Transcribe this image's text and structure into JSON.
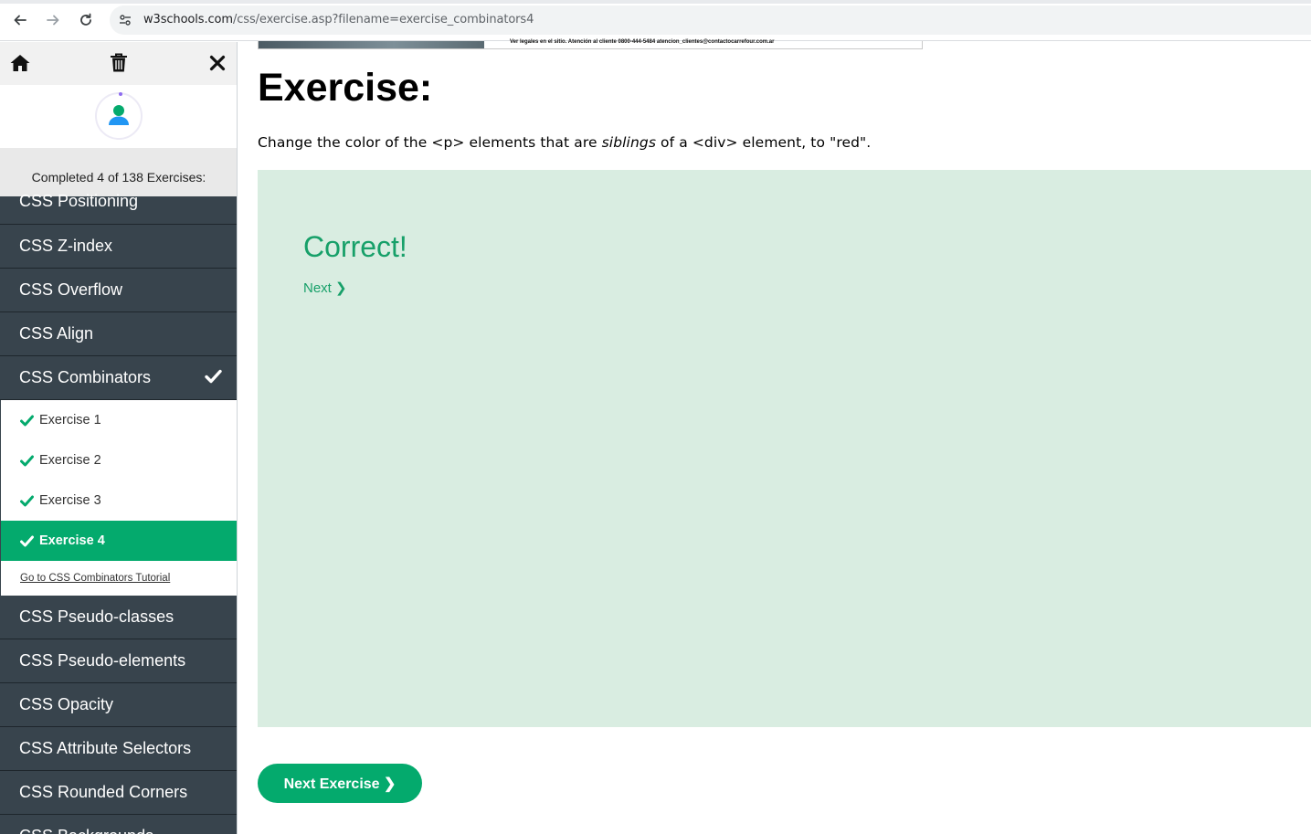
{
  "browser": {
    "url_host": "w3schools.com",
    "url_path": "/css/exercise.asp?filename=exercise_combinators4"
  },
  "sidebar": {
    "progress_text": "Completed 4 of 138 Exercises:",
    "items_before": [
      {
        "label": "CSS Positioning"
      },
      {
        "label": "CSS Z-index"
      },
      {
        "label": "CSS Overflow"
      },
      {
        "label": "CSS Align"
      }
    ],
    "current_section": {
      "label": "CSS Combinators"
    },
    "sub_items": [
      {
        "label": "Exercise 1"
      },
      {
        "label": "Exercise 2"
      },
      {
        "label": "Exercise 3"
      },
      {
        "label": "Exercise 4"
      }
    ],
    "tutorial_link": "Go to CSS Combinators Tutorial",
    "items_after": [
      {
        "label": "CSS Pseudo-classes"
      },
      {
        "label": "CSS Pseudo-elements"
      },
      {
        "label": "CSS Opacity"
      },
      {
        "label": "CSS Attribute Selectors"
      },
      {
        "label": "CSS Rounded Corners"
      },
      {
        "label": "CSS Backgrounds"
      }
    ]
  },
  "banner": {
    "text": "Ver legales en el sitio. Atención al cliente 0800-444-5484 atencion_clientes@contactocarrefour.com.ar"
  },
  "main": {
    "title": "Exercise:",
    "instruction_part1": "Change the color of the <p> elements that are ",
    "instruction_em": "siblings",
    "instruction_part2": " of a <div> element, to \"red\".",
    "result_title": "Correct!",
    "next_link": "Next ❯",
    "next_button": "Next Exercise ❯"
  },
  "colors": {
    "accent": "#04aa6d",
    "sidebar_bg": "#38444d",
    "result_bg": "#d9ede1"
  }
}
